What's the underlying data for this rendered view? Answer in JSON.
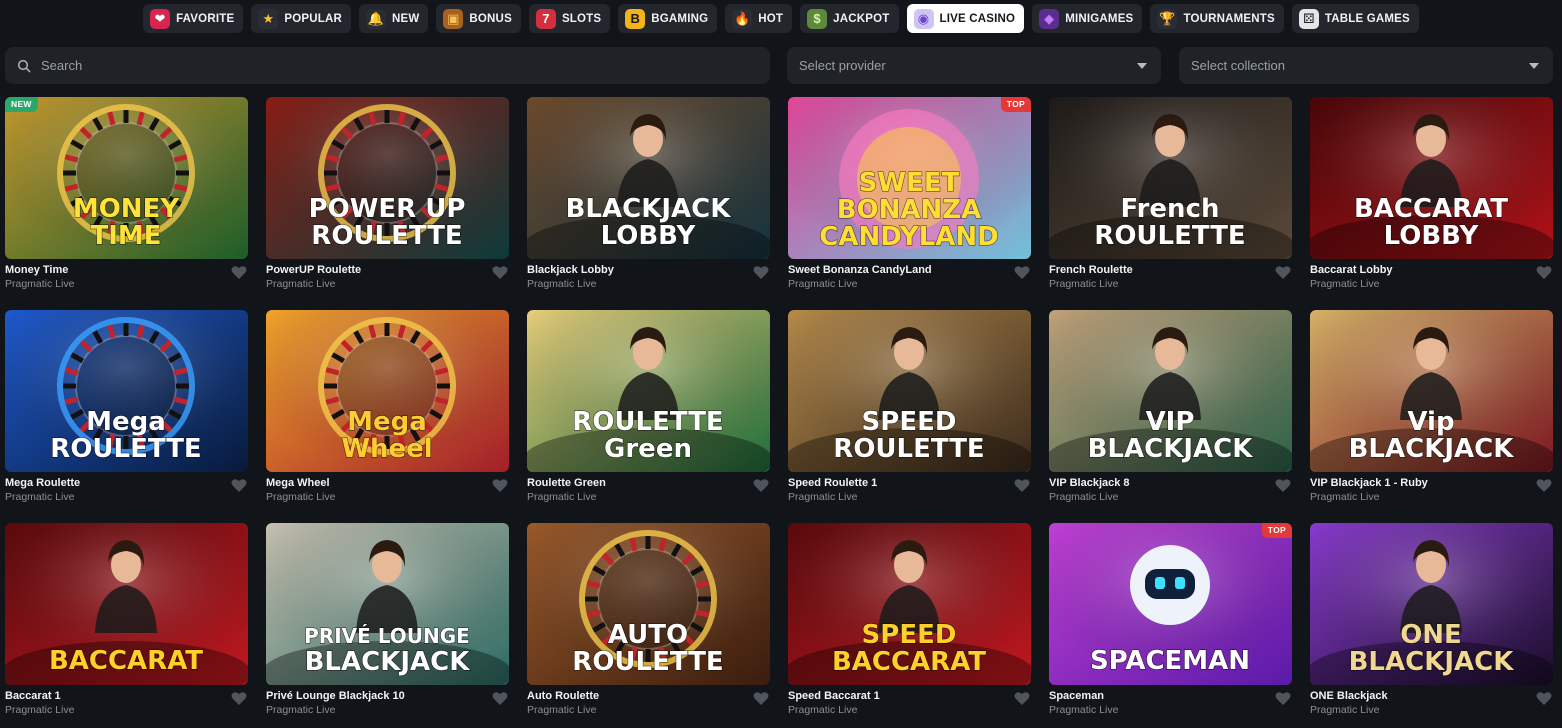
{
  "categories": [
    {
      "label": "FAVORITE",
      "icon": "heart-icon",
      "symbol": "❤",
      "bg": "#d8254f",
      "fg": "#ffffff"
    },
    {
      "label": "POPULAR",
      "icon": "star-icon",
      "symbol": "★",
      "bg": "#2a2d33",
      "fg": "#f6c22c"
    },
    {
      "label": "NEW",
      "icon": "bell-icon",
      "symbol": "🔔",
      "bg": "#2a2d33",
      "fg": "#f5b520"
    },
    {
      "label": "BONUS",
      "icon": "treasure-chest-icon",
      "symbol": "▣",
      "bg": "#a8621e",
      "fg": "#f9c35a"
    },
    {
      "label": "SLOTS",
      "icon": "slot-machine-icon",
      "symbol": "7",
      "bg": "#d42f3f",
      "fg": "#ffffff"
    },
    {
      "label": "BGAMING",
      "icon": "bgaming-logo-icon",
      "symbol": "B",
      "bg": "#f3b41b",
      "fg": "#1a1a1a"
    },
    {
      "label": "HOT",
      "icon": "fire-icon",
      "symbol": "🔥",
      "bg": "#2a2d33",
      "fg": "#ff6a1f"
    },
    {
      "label": "JACKPOT",
      "icon": "cash-icon",
      "symbol": "$",
      "bg": "#5c8a3a",
      "fg": "#d9f3b0"
    },
    {
      "label": "LIVE CASINO",
      "icon": "live-dealer-icon",
      "symbol": "◉",
      "bg": "#cfc4f2",
      "fg": "#6a44d4",
      "active": true
    },
    {
      "label": "MINIGAMES",
      "icon": "gem-icon",
      "symbol": "◆",
      "bg": "#5b2d8f",
      "fg": "#c27bff"
    },
    {
      "label": "TOURNAMENTS",
      "icon": "trophy-icon",
      "symbol": "🏆",
      "bg": "#2a2d33",
      "fg": "#f0a821"
    },
    {
      "label": "TABLE GAMES",
      "icon": "dice-icon",
      "symbol": "⚄",
      "bg": "#e3e5e8",
      "fg": "#222222"
    }
  ],
  "search": {
    "placeholder": "Search",
    "icon": "search-icon"
  },
  "provider_select": {
    "placeholder": "Select provider"
  },
  "collection_select": {
    "placeholder": "Select collection"
  },
  "games": [
    {
      "name": "Money Time",
      "provider": "Pragmatic Live",
      "badge": "NEW",
      "art": "MONEY|TIME",
      "theme": "gold",
      "bg": "#1d5c2a",
      "bg2": "#c89a2c",
      "text": "#ffe23a"
    },
    {
      "name": "PowerUP Roulette",
      "provider": "Pragmatic Live",
      "badge": "",
      "art": "POWER UP|ROULETTE",
      "theme": "wheel",
      "bg": "#0e3a3a",
      "bg2": "#8a1d14",
      "text": "#ffffff"
    },
    {
      "name": "Blackjack Lobby",
      "provider": "Pragmatic Live",
      "badge": "",
      "art": "BLACKJACK|LOBBY",
      "theme": "dealer",
      "bg": "#14323f",
      "bg2": "#6e4a2a",
      "text": "#ffffff"
    },
    {
      "name": "Sweet Bonanza CandyLand",
      "provider": "Pragmatic Live",
      "badge": "TOP",
      "art": "SWEET|BONANZA|CANDYLAND",
      "theme": "candy",
      "bg": "#6fc1d9",
      "bg2": "#e3459a",
      "text": "#ffdd33"
    },
    {
      "name": "French Roulette",
      "provider": "Pragmatic Live",
      "badge": "",
      "art": "French|ROULETTE",
      "theme": "dealer",
      "bg": "#5a4a3a",
      "bg2": "#1e1a18",
      "text": "#ffffff"
    },
    {
      "name": "Baccarat Lobby",
      "provider": "Pragmatic Live",
      "badge": "",
      "art": "BACCARAT|LOBBY",
      "theme": "dealer",
      "bg": "#b01218",
      "bg2": "#4a0608",
      "text": "#ffffff"
    },
    {
      "name": "Mega Roulette",
      "provider": "Pragmatic Live",
      "badge": "",
      "art": "Mega|ROULETTE",
      "theme": "neon",
      "bg": "#081a3a",
      "bg2": "#1d5ad0",
      "text": "#ffffff"
    },
    {
      "name": "Mega Wheel",
      "provider": "Pragmatic Live",
      "badge": "",
      "art": "Mega|Wheel",
      "theme": "wheel",
      "bg": "#a21e2a",
      "bg2": "#f2a52b",
      "text": "#ffcc33"
    },
    {
      "name": "Roulette Green",
      "provider": "Pragmatic Live",
      "badge": "",
      "art": "ROULETTE|Green",
      "theme": "dealer",
      "bg": "#1d6b3a",
      "bg2": "#e9cf7a",
      "text": "#ffffff"
    },
    {
      "name": "Speed Roulette 1",
      "provider": "Pragmatic Live",
      "badge": "",
      "art": "SPEED|ROULETTE",
      "theme": "dealer",
      "bg": "#3a2a1c",
      "bg2": "#b78b4a",
      "text": "#ffffff"
    },
    {
      "name": "VIP Blackjack 8",
      "provider": "Pragmatic Live",
      "badge": "",
      "art": "VIP|BLACKJACK",
      "theme": "dealer",
      "bg": "#2a6048",
      "bg2": "#c2a27a",
      "text": "#ffffff"
    },
    {
      "name": "VIP Blackjack 1 - Ruby",
      "provider": "Pragmatic Live",
      "badge": "",
      "art": "Vip|BLACKJACK",
      "theme": "dealer",
      "bg": "#7a1620",
      "bg2": "#d8b267",
      "text": "#ffffff"
    },
    {
      "name": "Baccarat 1",
      "provider": "Pragmatic Live",
      "badge": "",
      "art": "BACCARAT",
      "theme": "dealer",
      "bg": "#c01820",
      "bg2": "#5a0a0c",
      "text": "#ffd02a"
    },
    {
      "name": "Privé Lounge Blackjack 10",
      "provider": "Pragmatic Live",
      "badge": "",
      "art": "PRIVÉ LOUNGE|BLACKJACK",
      "theme": "dealer",
      "bg": "#2b6a62",
      "bg2": "#c8c2b2",
      "text": "#ffffff"
    },
    {
      "name": "Auto Roulette",
      "provider": "Pragmatic Live",
      "badge": "",
      "art": "AUTO|ROULETTE",
      "theme": "wheel",
      "bg": "#3a1c0e",
      "bg2": "#9a5a2a",
      "text": "#ffffff"
    },
    {
      "name": "Speed Baccarat 1",
      "provider": "Pragmatic Live",
      "badge": "",
      "art": "SPEED|BACCARAT",
      "theme": "dealer",
      "bg": "#c01820",
      "bg2": "#5a0a0c",
      "text": "#ffd02a"
    },
    {
      "name": "Spaceman",
      "provider": "Pragmatic Live",
      "badge": "TOP",
      "art": "SPACEMAN",
      "theme": "space",
      "bg": "#5a1aa8",
      "bg2": "#c13fd6",
      "text": "#ffffff"
    },
    {
      "name": "ONE Blackjack",
      "provider": "Pragmatic Live",
      "badge": "",
      "art": "ONE|BLACKJACK",
      "theme": "dealer",
      "bg": "#1a0e2a",
      "bg2": "#8a3ad0",
      "text": "#f0d890"
    }
  ]
}
